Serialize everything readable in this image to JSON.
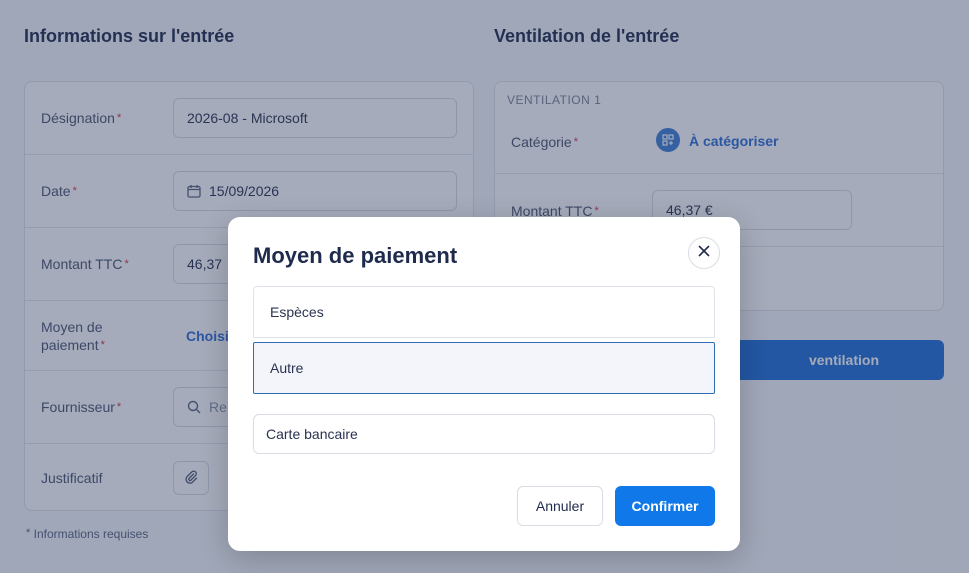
{
  "left": {
    "title": "Informations sur l'entrée",
    "designation_label": "Désignation",
    "designation_value": "2026-08 - Microsoft",
    "date_label": "Date",
    "date_value": "15/09/2026",
    "montant_label": "Montant TTC",
    "montant_value": "46,37",
    "moyen_label_1": "Moyen de",
    "moyen_label_2": "paiement",
    "moyen_link": "Choisi",
    "fournisseur_label": "Fournisseur",
    "fournisseur_placeholder": "Re",
    "justificatif_label": "Justificatif",
    "required_mark": "*"
  },
  "right": {
    "title": "Ventilation de l'entrée",
    "ventilation_label": "VENTILATION 1",
    "categorie_label": "Catégorie",
    "categorie_link": "À catégoriser",
    "montant_label": "Montant TTC",
    "montant_value": "46,37 €",
    "add_button": "ventilation"
  },
  "footnote": "Informations requises",
  "modal": {
    "title": "Moyen de paiement",
    "options": [
      "Espèces",
      "Autre"
    ],
    "text_value": "Carte bancaire",
    "cancel": "Annuler",
    "confirm": "Confirmer"
  }
}
